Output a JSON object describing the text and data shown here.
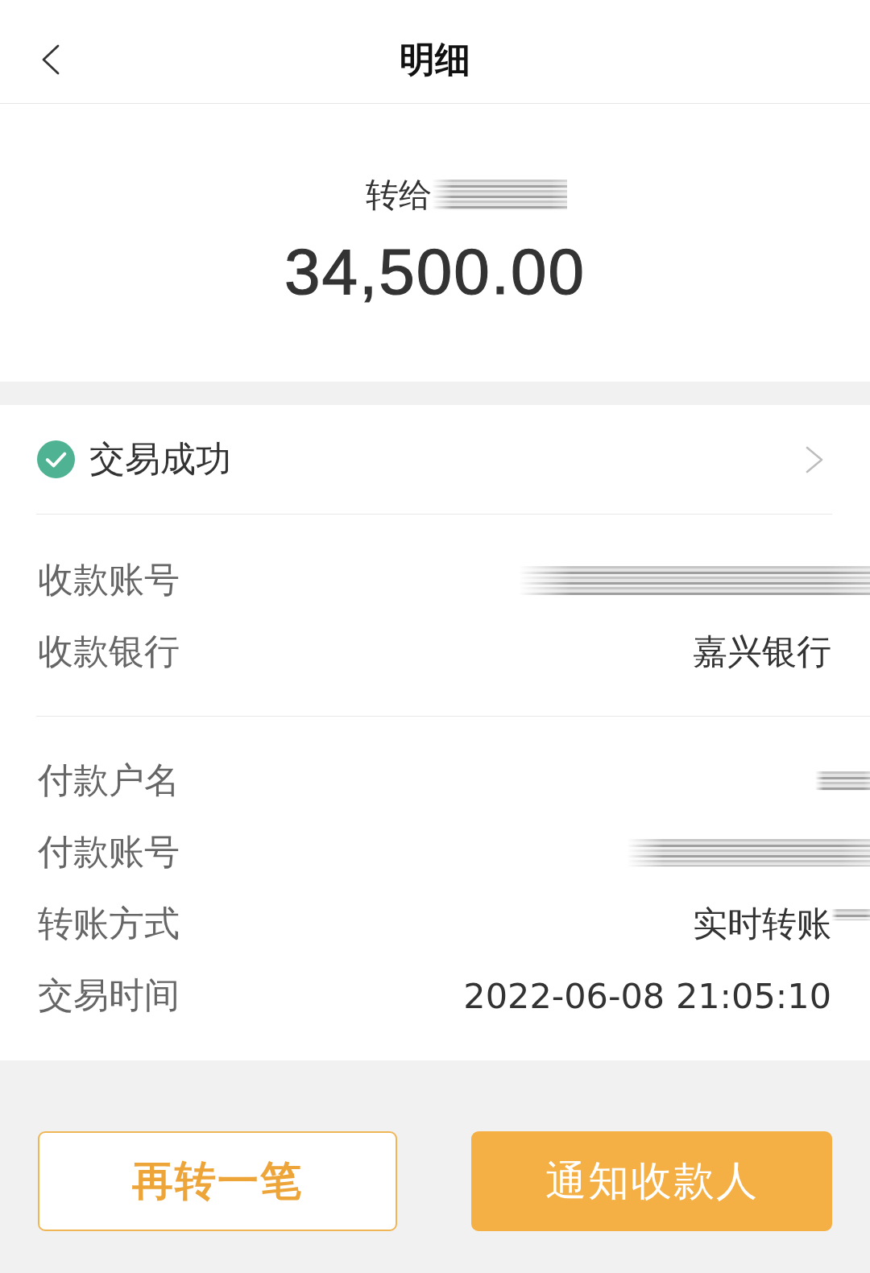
{
  "header": {
    "title": "明细"
  },
  "transfer": {
    "recipient_label": "转给",
    "recipient_redacted": true,
    "amount": "34,500.00"
  },
  "status": {
    "text": "交易成功"
  },
  "detail_groups": [
    {
      "rows": [
        {
          "label": "收款账号",
          "kind": "wide"
        },
        {
          "label": "收款银行",
          "value": "嘉兴银行",
          "kind": "plain"
        }
      ]
    },
    {
      "rows": [
        {
          "label": "付款户名",
          "kind": "narrow"
        },
        {
          "label": "付款账号",
          "kind": "medium"
        },
        {
          "label": "转账方式",
          "value": "实时转账",
          "kind": "smudged"
        },
        {
          "label": "交易时间",
          "value": "2022-06-08 21:05:10",
          "kind": "plain"
        }
      ]
    }
  ],
  "buttons": [
    {
      "label": "再转一笔",
      "kind": "outline"
    },
    {
      "label": "通知收款人",
      "kind": "filled"
    }
  ]
}
